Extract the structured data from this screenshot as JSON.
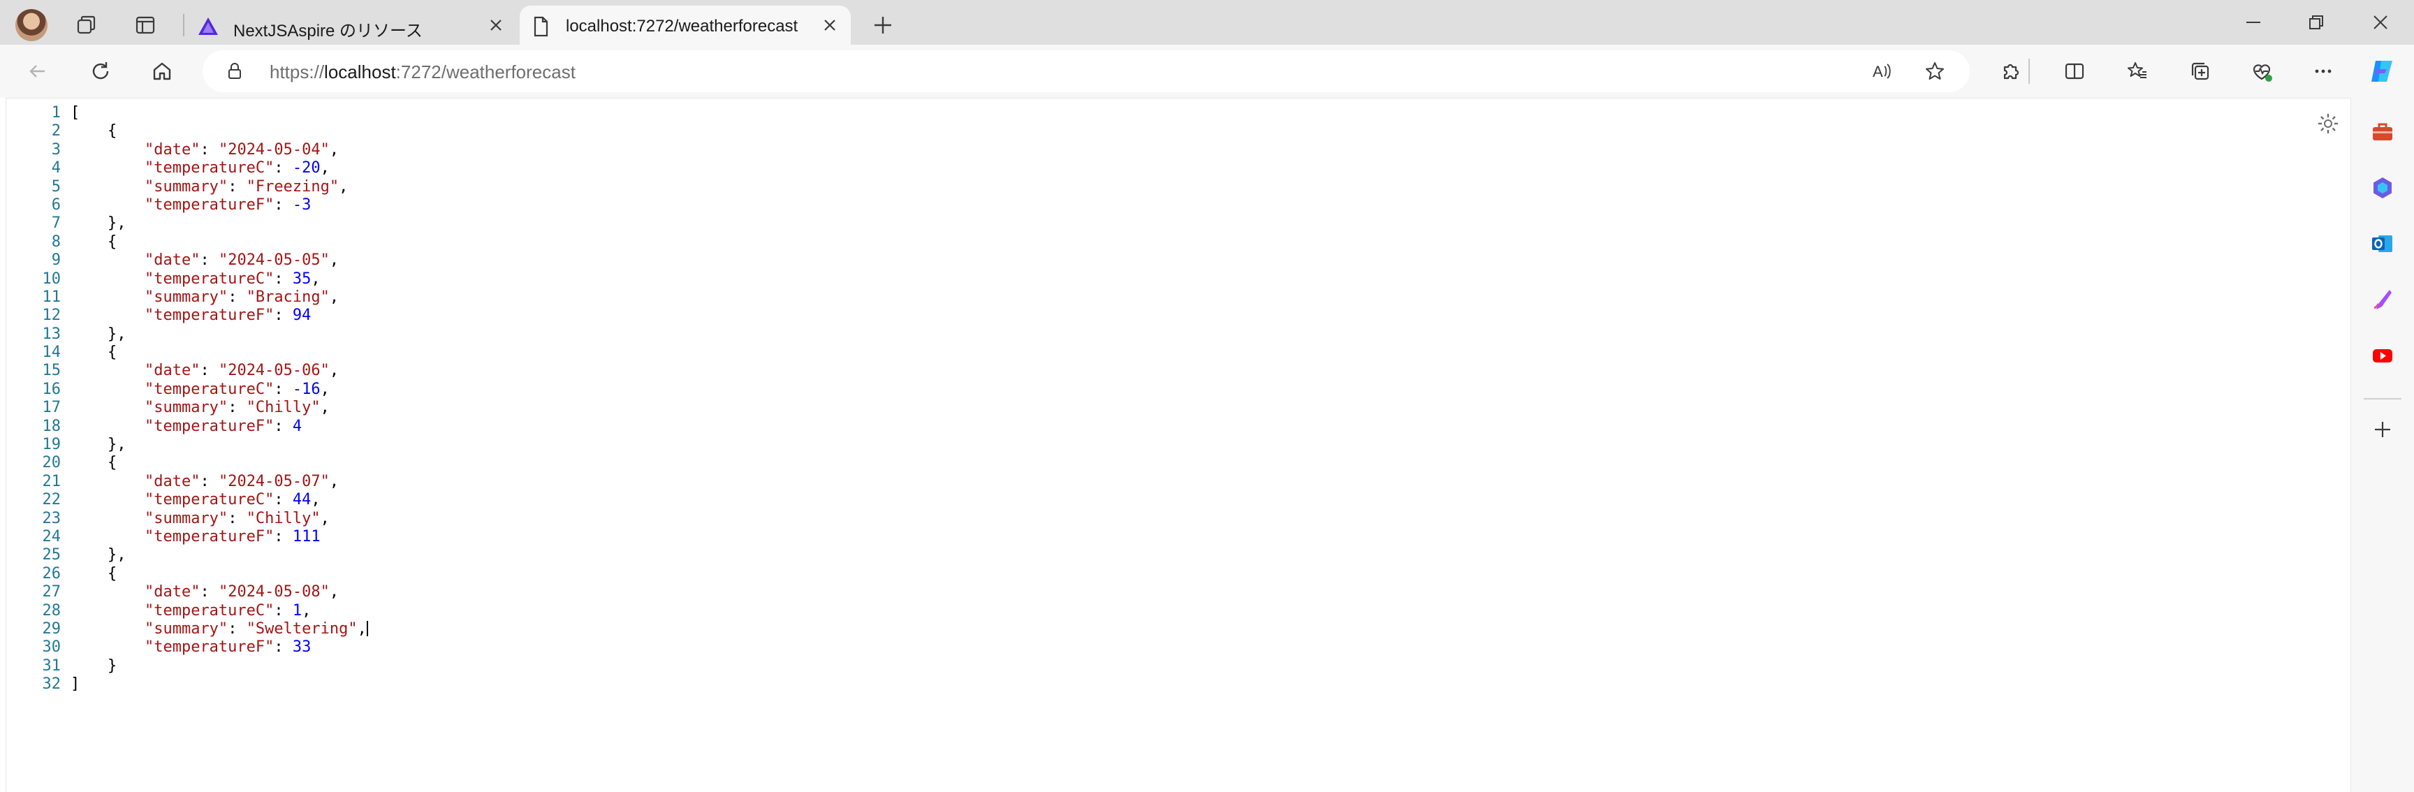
{
  "tabs": [
    {
      "title": "NextJSAspire のリソース",
      "active": false,
      "favicon": "aspire-logo-icon"
    },
    {
      "title": "localhost:7272/weatherforecast",
      "active": true,
      "favicon": "page-icon"
    }
  ],
  "address_bar": {
    "scheme": "https://",
    "host": "localhost",
    "rest": ":7272/weatherforecast"
  },
  "json_lines": [
    [
      [
        "p",
        "["
      ]
    ],
    [
      [
        "p",
        "    {"
      ]
    ],
    [
      [
        "p",
        "        "
      ],
      [
        "k",
        "\"date\""
      ],
      [
        "p",
        ": "
      ],
      [
        "s",
        "\"2024-05-04\""
      ],
      [
        "p",
        ","
      ]
    ],
    [
      [
        "p",
        "        "
      ],
      [
        "k",
        "\"temperatureC\""
      ],
      [
        "p",
        ": "
      ],
      [
        "n",
        "-20"
      ],
      [
        "p",
        ","
      ]
    ],
    [
      [
        "p",
        "        "
      ],
      [
        "k",
        "\"summary\""
      ],
      [
        "p",
        ": "
      ],
      [
        "s",
        "\"Freezing\""
      ],
      [
        "p",
        ","
      ]
    ],
    [
      [
        "p",
        "        "
      ],
      [
        "k",
        "\"temperatureF\""
      ],
      [
        "p",
        ": "
      ],
      [
        "n",
        "-3"
      ]
    ],
    [
      [
        "p",
        "    },"
      ]
    ],
    [
      [
        "p",
        "    {"
      ]
    ],
    [
      [
        "p",
        "        "
      ],
      [
        "k",
        "\"date\""
      ],
      [
        "p",
        ": "
      ],
      [
        "s",
        "\"2024-05-05\""
      ],
      [
        "p",
        ","
      ]
    ],
    [
      [
        "p",
        "        "
      ],
      [
        "k",
        "\"temperatureC\""
      ],
      [
        "p",
        ": "
      ],
      [
        "n",
        "35"
      ],
      [
        "p",
        ","
      ]
    ],
    [
      [
        "p",
        "        "
      ],
      [
        "k",
        "\"summary\""
      ],
      [
        "p",
        ": "
      ],
      [
        "s",
        "\"Bracing\""
      ],
      [
        "p",
        ","
      ]
    ],
    [
      [
        "p",
        "        "
      ],
      [
        "k",
        "\"temperatureF\""
      ],
      [
        "p",
        ": "
      ],
      [
        "n",
        "94"
      ]
    ],
    [
      [
        "p",
        "    },"
      ]
    ],
    [
      [
        "p",
        "    {"
      ]
    ],
    [
      [
        "p",
        "        "
      ],
      [
        "k",
        "\"date\""
      ],
      [
        "p",
        ": "
      ],
      [
        "s",
        "\"2024-05-06\""
      ],
      [
        "p",
        ","
      ]
    ],
    [
      [
        "p",
        "        "
      ],
      [
        "k",
        "\"temperatureC\""
      ],
      [
        "p",
        ": "
      ],
      [
        "n",
        "-16"
      ],
      [
        "p",
        ","
      ]
    ],
    [
      [
        "p",
        "        "
      ],
      [
        "k",
        "\"summary\""
      ],
      [
        "p",
        ": "
      ],
      [
        "s",
        "\"Chilly\""
      ],
      [
        "p",
        ","
      ]
    ],
    [
      [
        "p",
        "        "
      ],
      [
        "k",
        "\"temperatureF\""
      ],
      [
        "p",
        ": "
      ],
      [
        "n",
        "4"
      ]
    ],
    [
      [
        "p",
        "    },"
      ]
    ],
    [
      [
        "p",
        "    {"
      ]
    ],
    [
      [
        "p",
        "        "
      ],
      [
        "k",
        "\"date\""
      ],
      [
        "p",
        ": "
      ],
      [
        "s",
        "\"2024-05-07\""
      ],
      [
        "p",
        ","
      ]
    ],
    [
      [
        "p",
        "        "
      ],
      [
        "k",
        "\"temperatureC\""
      ],
      [
        "p",
        ": "
      ],
      [
        "n",
        "44"
      ],
      [
        "p",
        ","
      ]
    ],
    [
      [
        "p",
        "        "
      ],
      [
        "k",
        "\"summary\""
      ],
      [
        "p",
        ": "
      ],
      [
        "s",
        "\"Chilly\""
      ],
      [
        "p",
        ","
      ]
    ],
    [
      [
        "p",
        "        "
      ],
      [
        "k",
        "\"temperatureF\""
      ],
      [
        "p",
        ": "
      ],
      [
        "n",
        "111"
      ]
    ],
    [
      [
        "p",
        "    },"
      ]
    ],
    [
      [
        "p",
        "    {"
      ]
    ],
    [
      [
        "p",
        "        "
      ],
      [
        "k",
        "\"date\""
      ],
      [
        "p",
        ": "
      ],
      [
        "s",
        "\"2024-05-08\""
      ],
      [
        "p",
        ","
      ]
    ],
    [
      [
        "p",
        "        "
      ],
      [
        "k",
        "\"temperatureC\""
      ],
      [
        "p",
        ": "
      ],
      [
        "n",
        "1"
      ],
      [
        "p",
        ","
      ]
    ],
    [
      [
        "p",
        "        "
      ],
      [
        "k",
        "\"summary\""
      ],
      [
        "p",
        ": "
      ],
      [
        "s",
        "\"Sweltering\""
      ],
      [
        "p",
        ","
      ],
      [
        "c",
        ""
      ]
    ],
    [
      [
        "p",
        "        "
      ],
      [
        "k",
        "\"temperatureF\""
      ],
      [
        "p",
        ": "
      ],
      [
        "n",
        "33"
      ]
    ],
    [
      [
        "p",
        "    }"
      ]
    ],
    [
      [
        "p",
        "]"
      ]
    ]
  ],
  "colors": {
    "line_number": "#237893",
    "string": "#a31515",
    "number": "#0000ff",
    "tab_strip": "#dfdfdf"
  }
}
